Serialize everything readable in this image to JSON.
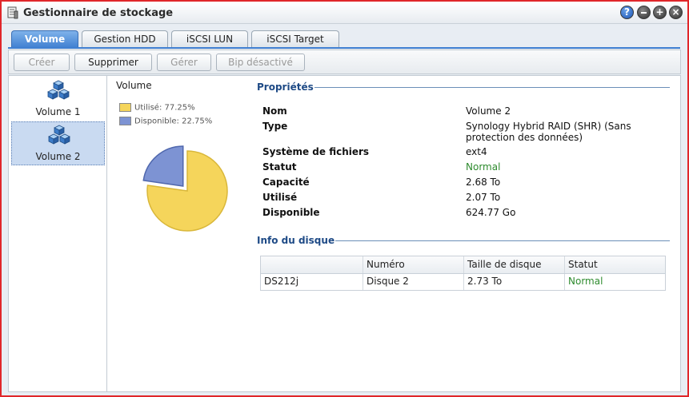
{
  "window": {
    "title": "Gestionnaire de stockage",
    "help_glyph": "?",
    "max_glyph": "+",
    "close_glyph": "×"
  },
  "tabs": [
    {
      "label": "Volume",
      "active": true
    },
    {
      "label": "Gestion HDD",
      "active": false
    },
    {
      "label": "iSCSI LUN",
      "active": false
    },
    {
      "label": "iSCSI Target",
      "active": false
    }
  ],
  "toolbar": {
    "create_label": "Créer",
    "delete_label": "Supprimer",
    "manage_label": "Gérer",
    "beep_label": "Bip désactivé"
  },
  "volumes": [
    {
      "label": "Volume 1",
      "selected": false
    },
    {
      "label": "Volume 2",
      "selected": true
    }
  ],
  "chart": {
    "title": "Volume",
    "legend": [
      {
        "label": "Utilisé: 77.25%",
        "color": "#f5d55b"
      },
      {
        "label": "Disponible: 22.75%",
        "color": "#7d93d3"
      }
    ]
  },
  "chart_data": {
    "type": "pie",
    "categories": [
      "Utilisé",
      "Disponible"
    ],
    "values": [
      77.25,
      22.75
    ],
    "colors": [
      "#f5d55b",
      "#7d93d3"
    ],
    "title": "Volume"
  },
  "properties": {
    "heading": "Propriétés",
    "rows": [
      {
        "label": "Nom",
        "value": "Volume 2",
        "status": false
      },
      {
        "label": "Type",
        "value": "Synology Hybrid RAID (SHR) (Sans protection des données)",
        "status": false
      },
      {
        "label": "Système de fichiers",
        "value": "ext4",
        "status": false
      },
      {
        "label": "Statut",
        "value": "Normal",
        "status": true
      },
      {
        "label": "Capacité",
        "value": "2.68 To",
        "status": false
      },
      {
        "label": "Utilisé",
        "value": "2.07 To",
        "status": false
      },
      {
        "label": "Disponible",
        "value": "624.77 Go",
        "status": false
      }
    ]
  },
  "disk_info": {
    "heading": "Info du disque",
    "columns": [
      "",
      "Numéro",
      "Taille de disque",
      "Statut"
    ],
    "rows": [
      [
        "DS212j",
        "Disque 2",
        "2.73 To",
        "Normal"
      ]
    ]
  },
  "colors": {
    "accent": "#3f7fd1",
    "status_ok": "#2e8b2e",
    "window_border": "#e0262a"
  }
}
